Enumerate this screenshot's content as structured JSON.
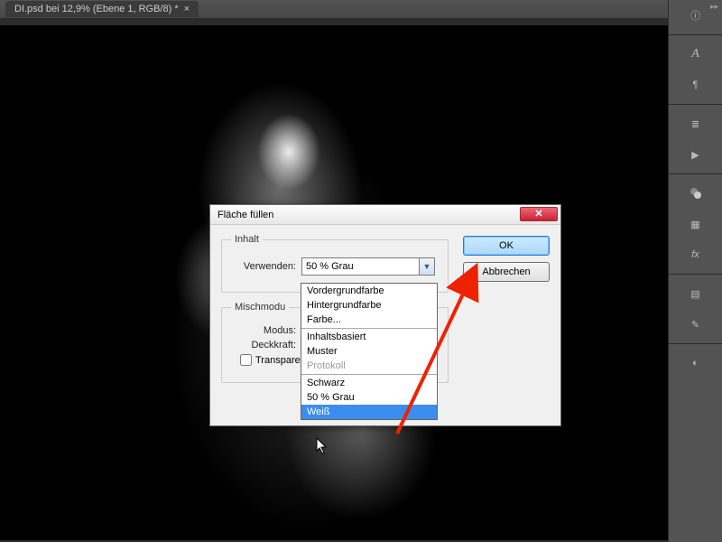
{
  "tab": {
    "title": "DI.psd bei 12,9% (Ebene 1, RGB/8) *",
    "close": "×"
  },
  "dialog": {
    "title": "Fläche füllen",
    "close": "✕",
    "group_content": "Inhalt",
    "use_label": "Verwenden:",
    "use_value": "50 % Grau",
    "group_blend": "Mischmodu",
    "mode_label": "Modus:",
    "opacity_label": "Deckkraft:",
    "transparency_label": "Transparen",
    "ok": "OK",
    "cancel": "Abbrechen"
  },
  "dropdown": {
    "opt0": "Vordergrundfarbe",
    "opt1": "Hintergrundfarbe",
    "opt2": "Farbe...",
    "opt3": "Inhaltsbasiert",
    "opt4": "Muster",
    "opt5": "Protokoll",
    "opt6": "Schwarz",
    "opt7": "50 % Grau",
    "opt8": "Weiß"
  },
  "icons": {
    "info": "ⓘ",
    "char": "A",
    "para": "¶",
    "sliders": "≣",
    "play": "▶",
    "swatch": "⬛",
    "grid": "▦",
    "fx": "fx",
    "layers": "▤",
    "brush": "✎",
    "adjust": "◐"
  }
}
